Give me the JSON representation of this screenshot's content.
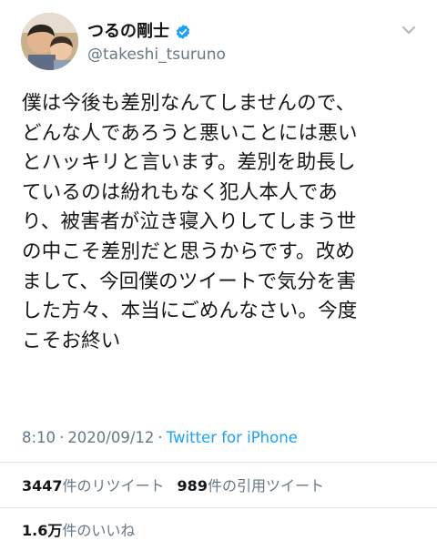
{
  "author": {
    "display_name": "つるの剛士",
    "handle": "@takeshi_tsuruno",
    "verified": true
  },
  "tweet": {
    "lines": [
      "僕は今後も差別なんてしませんので、",
      "どんな人であろうと悪いことには悪い",
      "とハッキリと言います。差別を助長し",
      "ているのは紛れもなく犯人本人であ",
      "り、被害者が泣き寝入りしてしまう世",
      "の中こそ差別だと思うからです。改め",
      "まして、今回僕のツイートで気分を害",
      "した方々、本当にごめんなさい。今度",
      "こそお終い"
    ],
    "time": "8:10",
    "separator": "·",
    "date": "2020/09/12",
    "source": "Twitter for iPhone"
  },
  "stats": {
    "retweets_count": "3447",
    "retweets_label": "件のリツイート",
    "quotes_count": "989",
    "quotes_label": "件の引用ツイート",
    "likes_count": "1.6万",
    "likes_label": "件のいいね"
  },
  "colors": {
    "accent": "#1da1f2",
    "secondary_text": "#657786",
    "divider": "#e1e8ed"
  },
  "icons": {
    "verified": "verified-badge-icon",
    "menu": "chevron-down-icon"
  }
}
